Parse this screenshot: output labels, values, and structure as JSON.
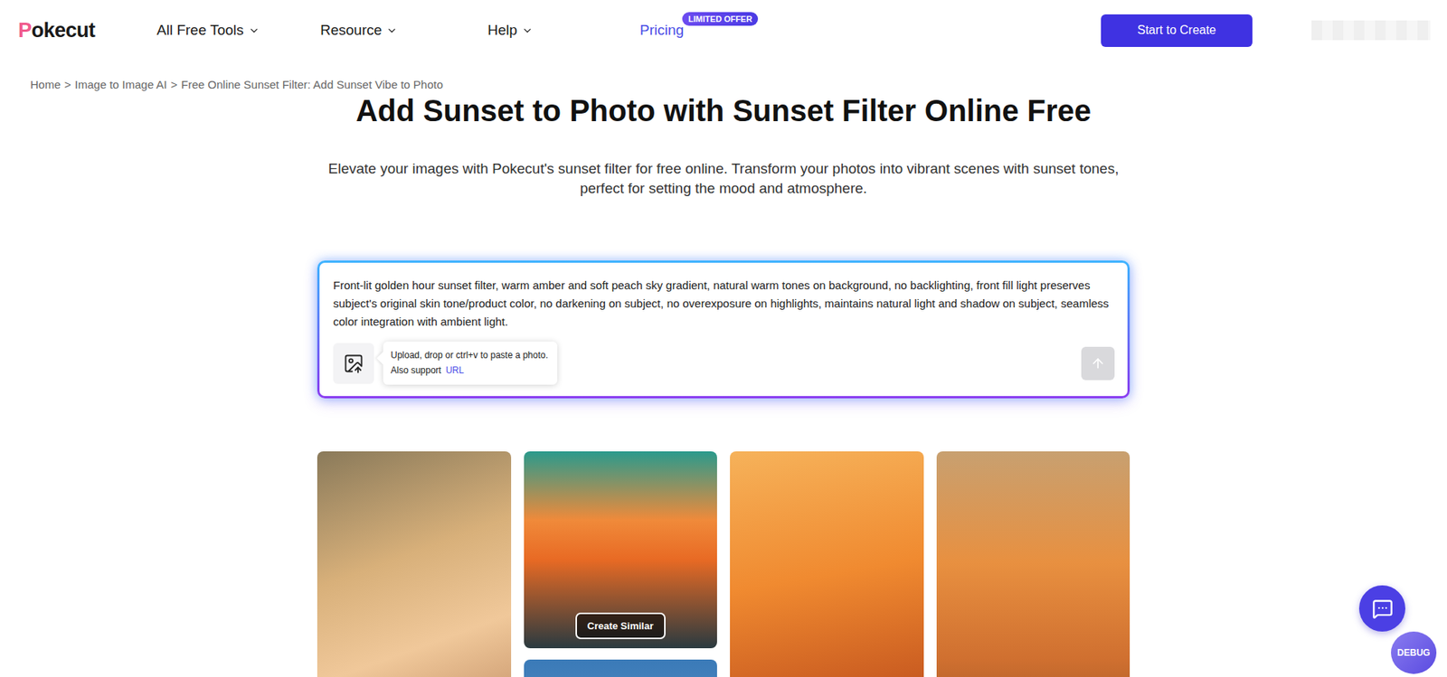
{
  "header": {
    "logo": "Pokecut",
    "nav": [
      {
        "label": "All Free Tools"
      },
      {
        "label": "Resource"
      },
      {
        "label": "Help"
      }
    ],
    "pricing": {
      "label": "Pricing",
      "badge": "LIMITED OFFER"
    },
    "cta": "Start to Create"
  },
  "breadcrumb": {
    "separator": ">",
    "items": [
      "Home",
      "Image to Image AI",
      "Free Online Sunset Filter: Add Sunset Vibe to Photo"
    ]
  },
  "hero": {
    "title": "Add Sunset to Photo with Sunset Filter Online Free",
    "subtitle": "Elevate your images with Pokecut's sunset filter for free online. Transform your photos into vibrant scenes with sunset tones, perfect for setting the mood and atmosphere."
  },
  "prompt": {
    "text": "Front-lit golden hour sunset filter, warm amber and soft peach sky gradient, natural warm tones on background, no backlighting, front fill light preserves subject's original skin tone/product color, no darkening on subject, no overexposure on highlights, maintains natural light and shadow on subject, seamless color integration with ambient light.",
    "tooltip": {
      "text": "Upload, drop or ctrl+v to paste a photo.",
      "also": "Also support",
      "link": "URL"
    },
    "send_disabled": true
  },
  "gallery": {
    "card_action": "Create Similar",
    "columns": [
      {
        "cards": [
          {
            "hovered": false
          }
        ]
      },
      {
        "cards": [
          {
            "hovered": true
          },
          {
            "hovered": false
          }
        ]
      },
      {
        "cards": [
          {
            "hovered": false
          }
        ]
      },
      {
        "cards": [
          {
            "hovered": false
          }
        ]
      }
    ]
  },
  "widgets": {
    "debug": "DEBUG"
  }
}
